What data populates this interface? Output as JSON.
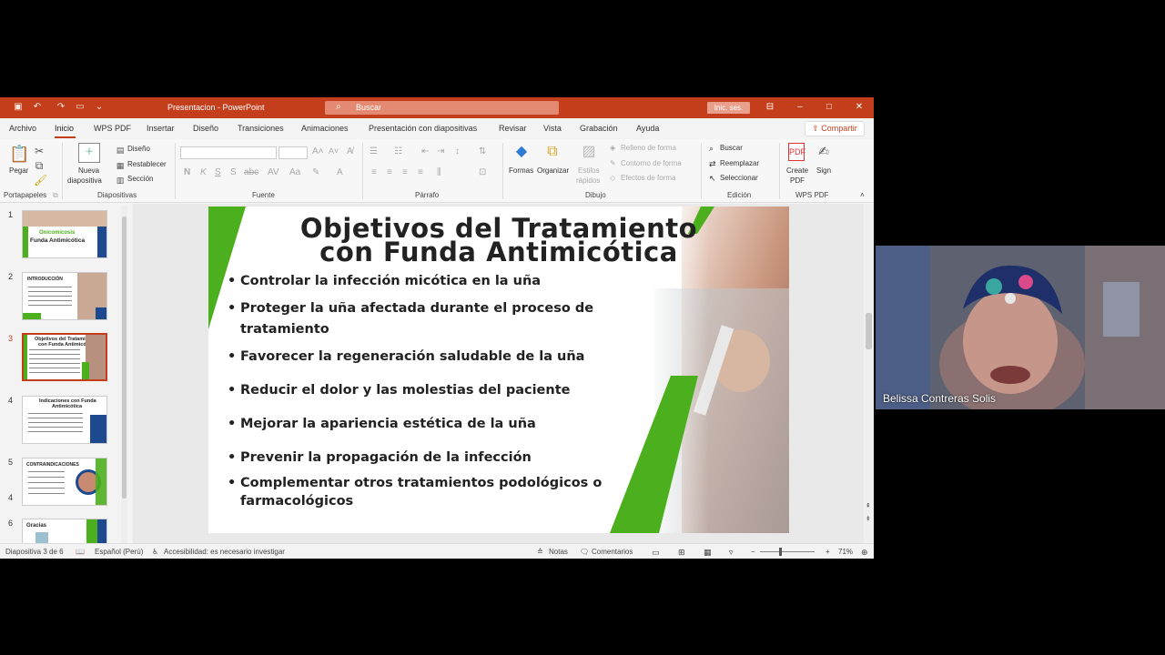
{
  "window": {
    "title": "Presentacion - PowerPoint",
    "search_placeholder": "Buscar",
    "signin_label": "Inic. ses."
  },
  "tabs": {
    "archivo": "Archivo",
    "inicio": "Inicio",
    "wps_pdf": "WPS PDF",
    "insertar": "Insertar",
    "diseno": "Diseño",
    "transiciones": "Transiciones",
    "animaciones": "Animaciones",
    "presentacion": "Presentación con diapositivas",
    "revisar": "Revisar",
    "vista": "Vista",
    "grabacion": "Grabación",
    "ayuda": "Ayuda",
    "share": "Compartir"
  },
  "ribbon": {
    "groups": {
      "portapapeles": "Portapapeles",
      "diapositivas": "Diapositivas",
      "fuente": "Fuente",
      "parrafo": "Párrafo",
      "dibujo": "Dibujo",
      "edicion": "Edición",
      "wps_pdf": "WPS PDF"
    },
    "pegar": "Pegar",
    "nueva_1": "Nueva",
    "nueva_2": "diapositiva",
    "diseno": "Diseño",
    "restablecer": "Restablecer",
    "seccion": "Sección",
    "formas": "Formas",
    "organizar": "Organizar",
    "estilos_1": "Estilos",
    "estilos_2": "rápidos",
    "relleno": "Relleno de forma",
    "contorno": "Contorno de forma",
    "efectos": "Efectos de forma",
    "buscar": "Buscar",
    "reemplazar": "Reemplazar",
    "seleccionar": "Seleccionar",
    "create_1": "Create",
    "create_2": "PDF",
    "sign": "Sign"
  },
  "thumbnails": [
    {
      "num": "1",
      "title_1": "Onicomicosis",
      "title_2": "Funda Antimicótica"
    },
    {
      "num": "2",
      "title": "INTRODUCCIÓN"
    },
    {
      "num": "3",
      "title_1": "Objetivos del Tratamiento",
      "title_2": "con Funda Antimicótica"
    },
    {
      "num": "4",
      "title_1": "Indicaciones con Funda",
      "title_2": "Antimicótica"
    },
    {
      "num": "5",
      "title": "CONTRAINDICACIONES"
    },
    {
      "num": "6",
      "title": "Gracias"
    }
  ],
  "slide": {
    "title_line_1": "Objetivos del Tratamiento",
    "title_line_2": "con Funda Antimicótica",
    "bullet_char": "•",
    "bullets": [
      "Controlar la infección micótica en la uña",
      "Proteger la uña afectada durante el proceso de",
      "tratamiento",
      "Favorecer la regeneración saludable de la uña",
      "Reducir el dolor y las molestias del paciente",
      "Mejorar la apariencia estética de la uña",
      "Prevenir la propagación de la infección",
      "Complementar otros tratamientos podológicos o",
      "farmacológicos"
    ]
  },
  "statusbar": {
    "slide_info": "Diapositiva 3 de 6",
    "language": "Español (Perú)",
    "accessibility": "Accesibilidad: es necesario investigar",
    "notas": "Notas",
    "comentarios": "Comentarios",
    "zoom": "71%"
  },
  "webcam": {
    "participant_name": "Belissa Contreras Solis"
  },
  "colors": {
    "ppt_accent": "#c43e1c",
    "slide_green": "#4caf1d"
  }
}
